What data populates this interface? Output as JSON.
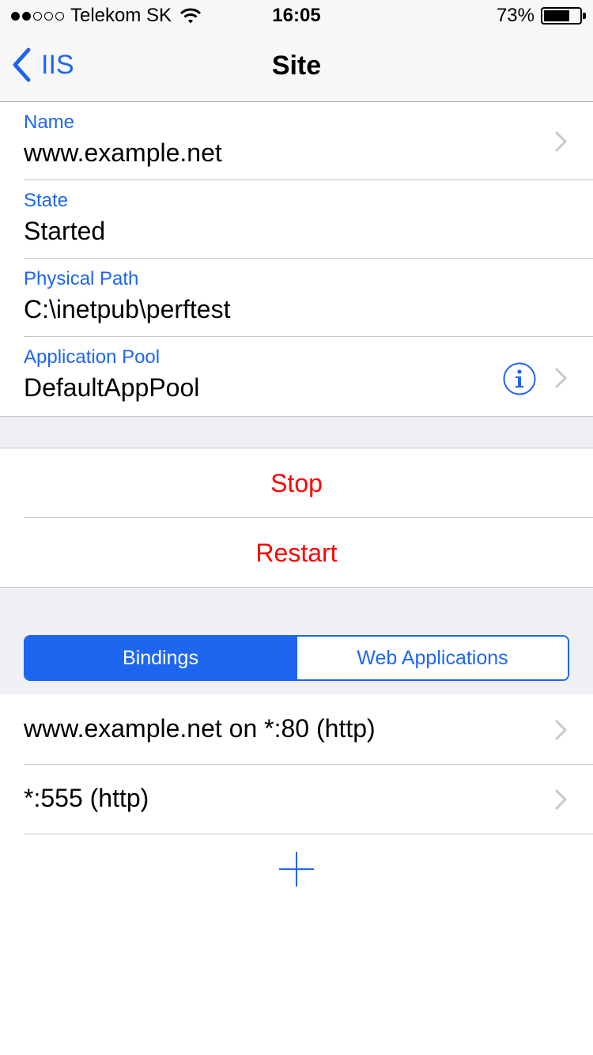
{
  "status_bar": {
    "carrier": "Telekom SK",
    "time": "16:05",
    "battery": "73%",
    "battery_level": 0.73,
    "signal_bars_filled": 2,
    "signal_bars_total": 5
  },
  "nav": {
    "back_label": "IIS",
    "title": "Site"
  },
  "details": [
    {
      "label": "Name",
      "value": "www.example.net"
    },
    {
      "label": "State",
      "value": "Started"
    },
    {
      "label": "Physical Path",
      "value": "C:\\inetpub\\perftest"
    },
    {
      "label": "Application Pool",
      "value": "DefaultAppPool"
    }
  ],
  "actions": {
    "stop": "Stop",
    "restart": "Restart"
  },
  "segment": {
    "bindings": "Bindings",
    "web_applications": "Web Applications",
    "selected": "Bindings"
  },
  "bindings": [
    "www.example.net on *:80 (http)",
    "*:555 (http)"
  ],
  "colors": {
    "accent": "#1e66f0",
    "destructive": "#ff0000",
    "group_background": "#efeff4"
  },
  "icons": {
    "back": "chevron-left-icon",
    "disclosure": "chevron-right-icon",
    "info": "info-icon",
    "add": "plus-icon",
    "wifi": "wifi-icon",
    "battery": "battery-icon"
  }
}
